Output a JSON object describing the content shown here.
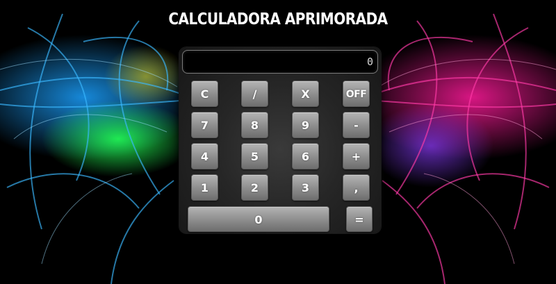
{
  "title": "CALCULADORA APRIMORADA",
  "display": {
    "value": "0"
  },
  "keys": {
    "clear": "C",
    "divide": "/",
    "multiply": "X",
    "off": "OFF",
    "seven": "7",
    "eight": "8",
    "nine": "9",
    "minus": "-",
    "four": "4",
    "five": "5",
    "six": "6",
    "plus": "+",
    "one": "1",
    "two": "2",
    "three": "3",
    "comma": ",",
    "zero": "0",
    "equals": "="
  },
  "colors": {
    "left_glow": "#1aa0ff",
    "right_glow": "#ff1a9a",
    "green_glow": "#22ff55",
    "button_face": "#9a9a9a",
    "calculator_body": "#262626"
  }
}
